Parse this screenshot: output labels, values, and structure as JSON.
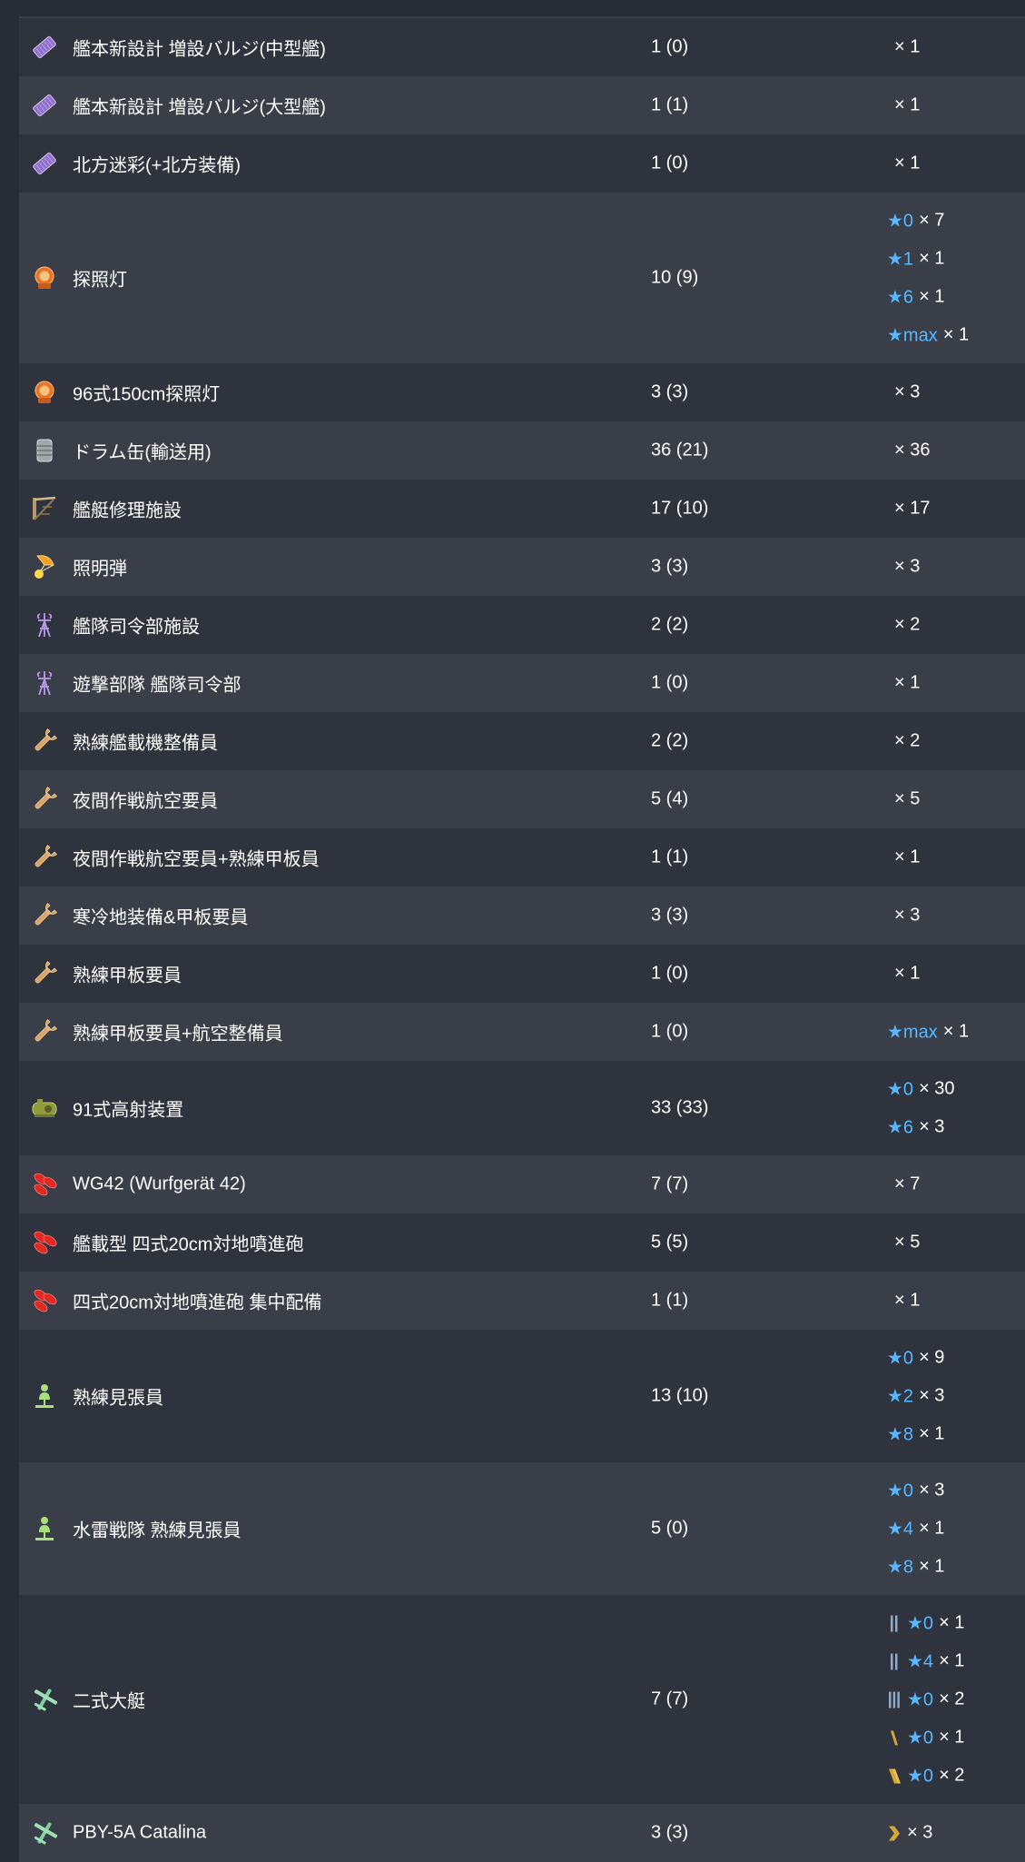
{
  "colors": {
    "star": "#59b7ff",
    "row_dark": "#2f333d",
    "row_light": "#393e48"
  },
  "rows": [
    {
      "icon": "bulge-icon",
      "name": "艦本新設計 増設バルジ(中型艦)",
      "count": "1 (0)",
      "improvements": [
        {
          "star": "",
          "count": "× 1"
        }
      ]
    },
    {
      "icon": "bulge-icon",
      "name": "艦本新設計 増設バルジ(大型艦)",
      "count": "1 (1)",
      "improvements": [
        {
          "star": "",
          "count": "× 1"
        }
      ]
    },
    {
      "icon": "bulge-icon",
      "name": "北方迷彩(+北方装備)",
      "count": "1 (0)",
      "improvements": [
        {
          "star": "",
          "count": "× 1"
        }
      ]
    },
    {
      "icon": "searchlight-icon",
      "name": "探照灯",
      "count": "10 (9)",
      "improvements": [
        {
          "star": "★0",
          "count": "× 7"
        },
        {
          "star": "★1",
          "count": "× 1"
        },
        {
          "star": "★6",
          "count": "× 1"
        },
        {
          "star": "★max",
          "count": "× 1"
        }
      ]
    },
    {
      "icon": "searchlight-icon",
      "name": "96式150cm探照灯",
      "count": "3 (3)",
      "improvements": [
        {
          "star": "",
          "count": "× 3"
        }
      ]
    },
    {
      "icon": "drum-canister-icon",
      "name": "ドラム缶(輸送用)",
      "count": "36 (21)",
      "improvements": [
        {
          "star": "",
          "count": "× 36"
        }
      ]
    },
    {
      "icon": "repair-facility-icon",
      "name": "艦艇修理施設",
      "count": "17 (10)",
      "improvements": [
        {
          "star": "",
          "count": "× 17"
        }
      ]
    },
    {
      "icon": "star-shell-icon",
      "name": "照明弾",
      "count": "3 (3)",
      "improvements": [
        {
          "star": "",
          "count": "× 3"
        }
      ]
    },
    {
      "icon": "fleet-command-icon",
      "name": "艦隊司令部施設",
      "count": "2 (2)",
      "improvements": [
        {
          "star": "",
          "count": "× 2"
        }
      ]
    },
    {
      "icon": "fleet-command-icon",
      "name": "遊撃部隊 艦隊司令部",
      "count": "1 (0)",
      "improvements": [
        {
          "star": "",
          "count": "× 1"
        }
      ]
    },
    {
      "icon": "wrench-icon",
      "name": "熟練艦載機整備員",
      "count": "2 (2)",
      "improvements": [
        {
          "star": "",
          "count": "× 2"
        }
      ]
    },
    {
      "icon": "wrench-icon",
      "name": "夜間作戦航空要員",
      "count": "5 (4)",
      "improvements": [
        {
          "star": "",
          "count": "× 5"
        }
      ]
    },
    {
      "icon": "wrench-icon",
      "name": "夜間作戦航空要員+熟練甲板員",
      "count": "1 (1)",
      "improvements": [
        {
          "star": "",
          "count": "× 1"
        }
      ]
    },
    {
      "icon": "wrench-icon",
      "name": "寒冷地装備&甲板要員",
      "count": "3 (3)",
      "improvements": [
        {
          "star": "",
          "count": "× 3"
        }
      ]
    },
    {
      "icon": "wrench-icon",
      "name": "熟練甲板要員",
      "count": "1 (0)",
      "improvements": [
        {
          "star": "",
          "count": "× 1"
        }
      ]
    },
    {
      "icon": "wrench-icon",
      "name": "熟練甲板要員+航空整備員",
      "count": "1 (0)",
      "improvements": [
        {
          "star": "★max",
          "count": "× 1"
        }
      ]
    },
    {
      "icon": "aa-fire-director-icon",
      "name": "91式高射装置",
      "count": "33 (33)",
      "improvements": [
        {
          "star": "★0",
          "count": "× 30"
        },
        {
          "star": "★6",
          "count": "× 3"
        }
      ]
    },
    {
      "icon": "rocket-launcher-icon",
      "name": "WG42 (Wurfgerät 42)",
      "count": "7 (7)",
      "improvements": [
        {
          "star": "",
          "count": "× 7"
        }
      ]
    },
    {
      "icon": "rocket-launcher-icon",
      "name": "艦載型 四式20cm対地噴進砲",
      "count": "5 (5)",
      "improvements": [
        {
          "star": "",
          "count": "× 5"
        }
      ]
    },
    {
      "icon": "rocket-launcher-icon",
      "name": "四式20cm対地噴進砲 集中配備",
      "count": "1 (1)",
      "improvements": [
        {
          "star": "",
          "count": "× 1"
        }
      ]
    },
    {
      "icon": "lookout-icon",
      "name": "熟練見張員",
      "count": "13 (10)",
      "improvements": [
        {
          "star": "★0",
          "count": "× 9"
        },
        {
          "star": "★2",
          "count": "× 3"
        },
        {
          "star": "★8",
          "count": "× 1"
        }
      ]
    },
    {
      "icon": "lookout-icon",
      "name": "水雷戦隊 熟練見張員",
      "count": "5 (0)",
      "improvements": [
        {
          "star": "★0",
          "count": "× 3"
        },
        {
          "star": "★4",
          "count": "× 1"
        },
        {
          "star": "★8",
          "count": "× 1"
        }
      ]
    },
    {
      "icon": "flying-boat-icon",
      "name": "二式大艇",
      "count": "7 (7)",
      "improvements": [
        {
          "prof": "blue-2",
          "star": "★0",
          "count": "× 1"
        },
        {
          "prof": "blue-2",
          "star": "★4",
          "count": "× 1"
        },
        {
          "prof": "blue-3",
          "star": "★0",
          "count": "× 2"
        },
        {
          "prof": "gold-1",
          "star": "★0",
          "count": "× 1"
        },
        {
          "prof": "gold-2",
          "star": "★0",
          "count": "× 2"
        }
      ]
    },
    {
      "icon": "flying-boat-icon",
      "name": "PBY-5A Catalina",
      "count": "3 (3)",
      "improvements": [
        {
          "prof": "gold-chevron",
          "star": "",
          "count": "× 3"
        }
      ]
    }
  ]
}
